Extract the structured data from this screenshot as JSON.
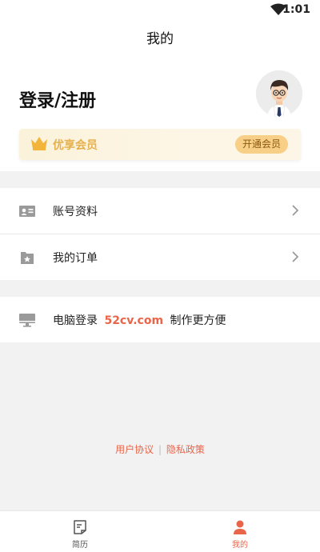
{
  "status_bar": {
    "time": "1:01",
    "wifi_icon": "wifi-icon"
  },
  "header": {
    "title": "我的"
  },
  "profile": {
    "login_label": "登录/注册",
    "avatar_icon": "avatar-cartoon"
  },
  "vip": {
    "label": "优享会员",
    "button": "开通会员",
    "crown_icon": "crown-icon",
    "accent": "#e6b04c"
  },
  "menu": {
    "items": [
      {
        "label": "账号资料",
        "icon": "id-card-icon"
      },
      {
        "label": "我的订单",
        "icon": "order-box-icon"
      }
    ],
    "pc": {
      "prefix": "电脑登录",
      "site": "52cv.com",
      "suffix": "制作更方便",
      "icon": "monitor-icon"
    }
  },
  "footer_links": {
    "agreement": "用户协议",
    "separator": "|",
    "privacy": "隐私政策"
  },
  "tabbar": {
    "tabs": [
      {
        "label": "简历",
        "icon": "resume-icon",
        "active": false
      },
      {
        "label": "我的",
        "icon": "person-icon",
        "active": true
      }
    ]
  },
  "colors": {
    "accent": "#e9654a",
    "vip_button": "#f8cf86"
  }
}
